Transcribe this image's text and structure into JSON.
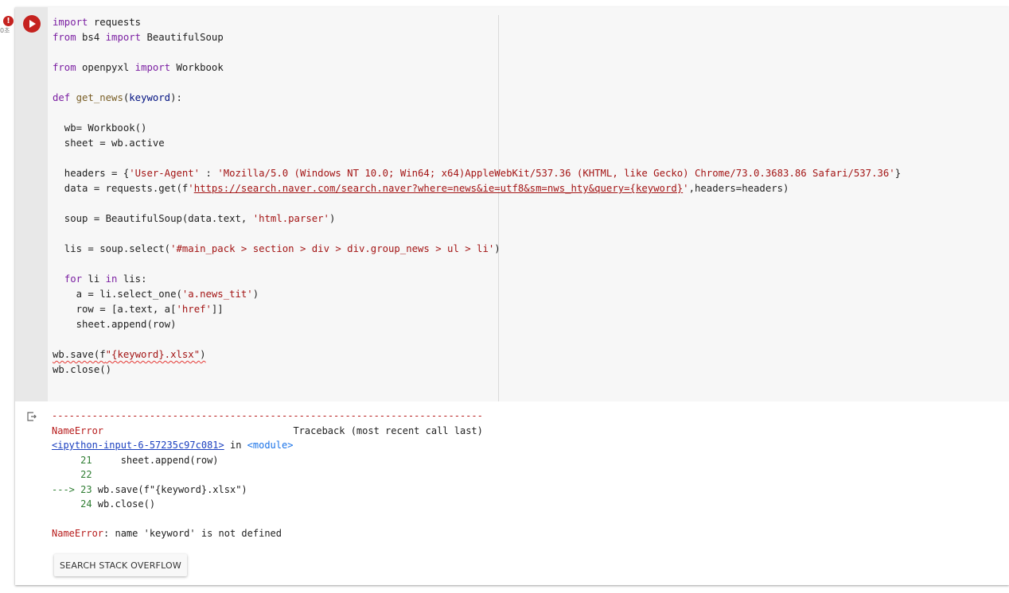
{
  "status": {
    "error_badge": "!",
    "exec_time": "0초"
  },
  "code_lines": [
    "import requests",
    "from bs4 import BeautifulSoup",
    "",
    "from openpyxl import Workbook",
    "",
    "def get_news(keyword):",
    "",
    "  wb= Workbook()",
    "  sheet = wb.active",
    "",
    "  headers = {'User-Agent' : 'Mozilla/5.0 (Windows NT 10.0; Win64; x64)AppleWebKit/537.36 (KHTML, like Gecko) Chrome/73.0.3683.86 Safari/537.36'}",
    "  data = requests.get(f'https://search.naver.com/search.naver?where=news&ie=utf8&sm=nws_hty&query={keyword}',headers=headers)",
    "",
    "  soup = BeautifulSoup(data.text, 'html.parser')",
    "",
    "  lis = soup.select('#main_pack > section > div > div.group_news > ul > li')",
    "",
    "  for li in lis:",
    "    a = li.select_one('a.news_tit')",
    "    row = [a.text, a['href']]",
    "    sheet.append(row)",
    "",
    "wb.save(f\"{keyword}.xlsx\")",
    "wb.close()"
  ],
  "output": {
    "separator": "---------------------------------------------------------------------------",
    "error_type": "NameError",
    "traceback_header": "Traceback (most recent call last)",
    "input_ref": "<ipython-input-6-57235c97c081>",
    "in_word": " in ",
    "module_ref": "<module>",
    "tb_lines": [
      {
        "prefix": "     ",
        "num": "21",
        "code": "     sheet.append(row)"
      },
      {
        "prefix": "     ",
        "num": "22",
        "code": ""
      },
      {
        "prefix": "---> ",
        "num": "23",
        "code": " wb.save(f\"{keyword}.xlsx\")"
      },
      {
        "prefix": "     ",
        "num": "24",
        "code": " wb.close()"
      }
    ],
    "error_message": ": name 'keyword' is not defined"
  },
  "buttons": {
    "search_stack_overflow": "SEARCH STACK OVERFLOW"
  },
  "icons": {
    "run": "play-circle-icon",
    "output": "output-exit-icon",
    "error": "error-badge-icon"
  },
  "colors": {
    "run_button": "#c5221f",
    "keyword": "#7b1fa2",
    "string": "#a31515",
    "error": "#b71c1c",
    "line_number": "#2e7d32"
  }
}
